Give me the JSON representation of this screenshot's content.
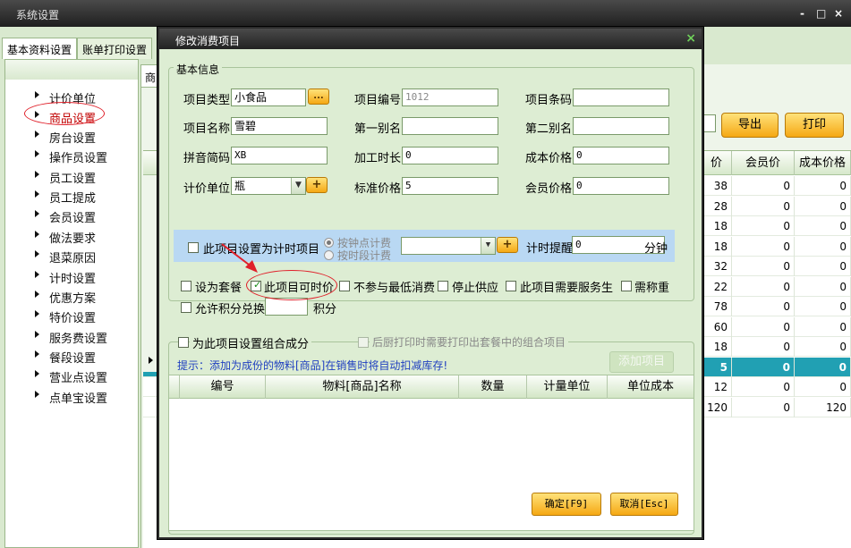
{
  "main": {
    "title": "系统设置",
    "controls": {
      "minimize": "-",
      "maximize": "□",
      "close": "×"
    },
    "tabs": [
      "基本资料设置",
      "账单打印设置"
    ],
    "sidebar": [
      "计价单位",
      "商品设置",
      "房台设置",
      "操作员设置",
      "员工设置",
      "员工提成",
      "会员设置",
      "做法要求",
      "退菜原因",
      "计时设置",
      "优惠方案",
      "特价设置",
      "服务费设置",
      "餐段设置",
      "营业点设置",
      "点单宝设置"
    ],
    "content_tab": "商",
    "buttons": {
      "export": "导出",
      "print": "打印"
    },
    "grid": {
      "headers": [
        "价",
        "会员价",
        "成本价格"
      ],
      "rows": [
        [
          "38",
          "0",
          "0"
        ],
        [
          "28",
          "0",
          "0"
        ],
        [
          "18",
          "0",
          "0"
        ],
        [
          "18",
          "0",
          "0"
        ],
        [
          "32",
          "0",
          "0"
        ],
        [
          "22",
          "0",
          "0"
        ],
        [
          "78",
          "0",
          "0"
        ],
        [
          "60",
          "0",
          "0"
        ],
        [
          "18",
          "0",
          "0"
        ],
        [
          "5",
          "0",
          "0"
        ],
        [
          "12",
          "0",
          "0"
        ],
        [
          "120",
          "0",
          "120"
        ]
      ]
    }
  },
  "dialog": {
    "title": "修改消费项目",
    "close": "×",
    "basic_group": "基本信息",
    "labels": {
      "type": "项目类型",
      "code": "项目编号",
      "barcode": "项目条码",
      "name": "项目名称",
      "alias1": "第一别名",
      "alias2": "第二别名",
      "pinyin": "拼音简码",
      "proc_time": "加工时长",
      "cost": "成本价格",
      "unit": "计价单位",
      "std_price": "标准价格",
      "member_price": "会员价格"
    },
    "values": {
      "type": "小食品",
      "code": "1012",
      "barcode": "",
      "name": "雪碧",
      "alias1": "",
      "alias2": "",
      "pinyin": "XB",
      "proc_time": "0",
      "cost": "0",
      "unit": "瓶",
      "std_price": "5",
      "member_price": "0"
    },
    "ellipsis": "...",
    "plus": "+",
    "timer": {
      "checkbox": "此项目设置为计时项目",
      "radio1": "按钟点计费",
      "radio2": "按时段计费",
      "remind_label": "计时提醒",
      "remind_value": "0",
      "minute": "分钟"
    },
    "options": {
      "set_meal": "设为套餐",
      "timed_price": "此项目可时价",
      "no_min": "不参与最低消费",
      "stop": "停止供应",
      "need_waiter": "此项目需要服务生",
      "weigh": "需称重",
      "points": "允许积分兑换",
      "points_unit": "积分"
    },
    "combo": {
      "checkbox": "为此项目设置组合成分",
      "kitchen": "后厨打印时需要打印出套餐中的组合项目",
      "tip": "提示：添加为成份的物料[商品]在销售时将自动扣减库存!",
      "add_btn": "添加项目",
      "headers": [
        "编号",
        "物料[商品]名称",
        "数量",
        "计量单位",
        "单位成本"
      ]
    },
    "ok": "确定[F9]",
    "cancel": "取消[Esc]"
  },
  "colors": {
    "accent": "#f5a814",
    "panel": "#ddedd3",
    "selection": "#21a0b3",
    "annotation": "#e0202a"
  }
}
